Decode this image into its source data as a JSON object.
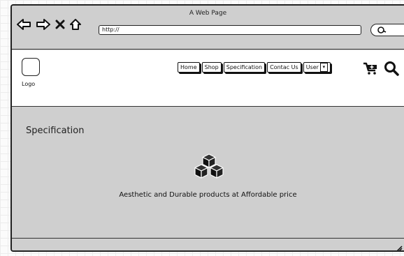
{
  "window": {
    "title": "A Web Page"
  },
  "browser": {
    "url": "http://",
    "nav": [
      "back-arrow-icon",
      "forward-arrow-icon",
      "close-icon",
      "home-icon"
    ]
  },
  "header": {
    "logo_label": "Logo",
    "menu": [
      "Home",
      "Shop",
      "Specification",
      "Contac Us"
    ],
    "user_label": "User",
    "user_caret": "▾",
    "icons": [
      "shopping-cart-icon",
      "search-icon"
    ]
  },
  "content": {
    "title": "Specification",
    "icon": "cubes-icon",
    "tagline": "Aesthetic and Durable products at Affordable price"
  }
}
